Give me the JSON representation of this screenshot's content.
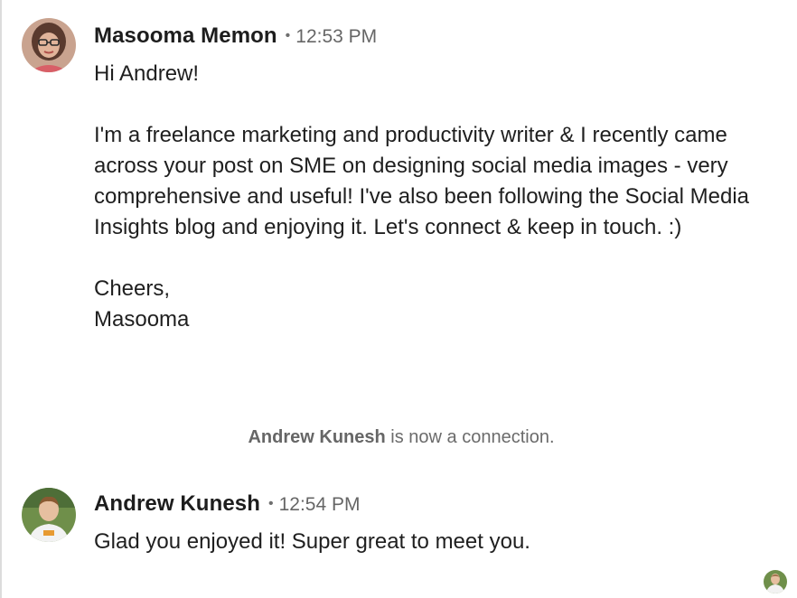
{
  "conversation": {
    "messages": [
      {
        "sender": "Masooma Memon",
        "separator": "•",
        "time": "12:53 PM",
        "avatar": "profile-photo-masooma",
        "body": "Hi Andrew!\n\nI'm a freelance marketing and productivity writer & I recently came across your post on SME on designing social media images - very comprehensive and useful! I've also been following the Social Media Insights blog and enjoying it. Let's connect & keep in touch. :)\n\nCheers,\nMasooma"
      },
      {
        "sender": "Andrew Kunesh",
        "separator": "•",
        "time": "12:54 PM",
        "avatar": "profile-photo-andrew",
        "body": "Glad you enjoyed it! Super great to meet you."
      }
    ],
    "system_note": {
      "name": "Andrew Kunesh",
      "text": " is now a connection."
    },
    "read_receipt": {
      "avatar": "read-receipt-avatar"
    }
  },
  "colors": {
    "sender": "#1d1d1d",
    "timestamp": "#666666",
    "body": "#1f1f1f",
    "system_note": "#6b6b6b",
    "left_border": "#dcdcdc"
  }
}
